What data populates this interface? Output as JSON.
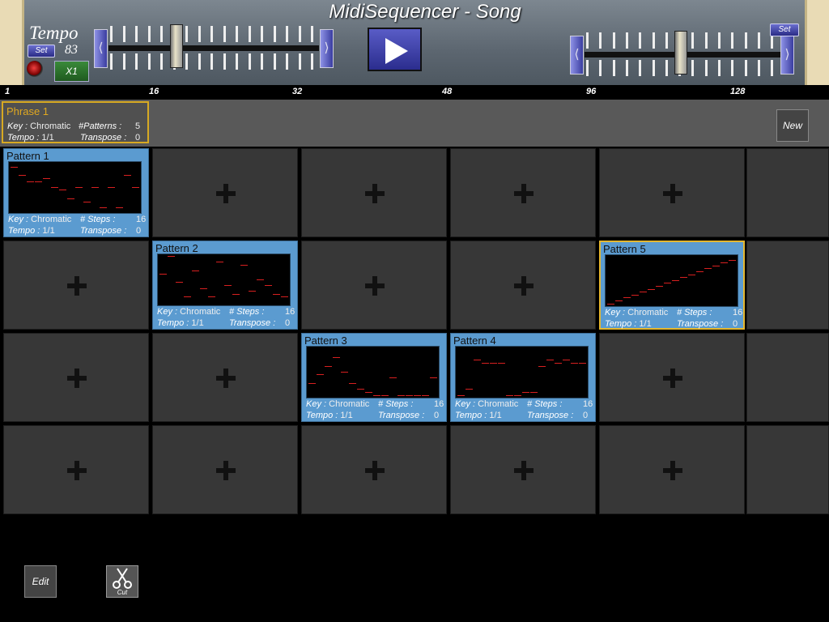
{
  "header": {
    "title": "MidiSequencer - Song",
    "tempo_label": "Tempo",
    "tempo_value": "83",
    "tempo_set_label": "Set",
    "multiplier_label": "X1",
    "right_set_label": "Set",
    "left_arrow": "⟨",
    "right_arrow": "⟩"
  },
  "ruler": {
    "labels": [
      "1",
      "16",
      "32",
      "48",
      "96",
      "128"
    ]
  },
  "phrase": {
    "title": "Phrase 1",
    "key_label": "Key :",
    "key": "Chromatic",
    "patterns_label": "#Patterns :",
    "patterns": "5",
    "tempo_label": "Tempo :",
    "tempo": "1/1",
    "transpose_label": "Transpose :",
    "transpose": "0",
    "new_label": "New"
  },
  "patterns": [
    {
      "title": "Pattern 1",
      "key_label": "Key :",
      "key": "Chromatic",
      "steps_label": "# Steps :",
      "steps": "16",
      "tempo_label": "Tempo :",
      "tempo": "1/1",
      "transpose_label": "Transpose :",
      "transpose": "0"
    },
    {
      "title": "Pattern 2",
      "key_label": "Key :",
      "key": "Chromatic",
      "steps_label": "# Steps :",
      "steps": "16",
      "tempo_label": "Tempo :",
      "tempo": "1/1",
      "transpose_label": "Transpose :",
      "transpose": "0"
    },
    {
      "title": "Pattern 3",
      "key_label": "Key :",
      "key": "Chromatic",
      "steps_label": "# Steps :",
      "steps": "16",
      "tempo_label": "Tempo :",
      "tempo": "1/1",
      "transpose_label": "Transpose :",
      "transpose": "0"
    },
    {
      "title": "Pattern 4",
      "key_label": "Key :",
      "key": "Chromatic",
      "steps_label": "# Steps :",
      "steps": "16",
      "tempo_label": "Tempo :",
      "tempo": "1/1",
      "transpose_label": "Transpose :",
      "transpose": "0"
    },
    {
      "title": "Pattern 5",
      "key_label": "Key :",
      "key": "Chromatic",
      "steps_label": "# Steps :",
      "steps": "16",
      "tempo_label": "Tempo :",
      "tempo": "1/1",
      "transpose_label": "Transpose :",
      "transpose": "0"
    }
  ],
  "toolbar": {
    "edit_label": "Edit",
    "cut_label": "Cut"
  },
  "colors": {
    "accent": "#5b9bd0",
    "selected": "#e4b730",
    "note": "#d82020"
  }
}
